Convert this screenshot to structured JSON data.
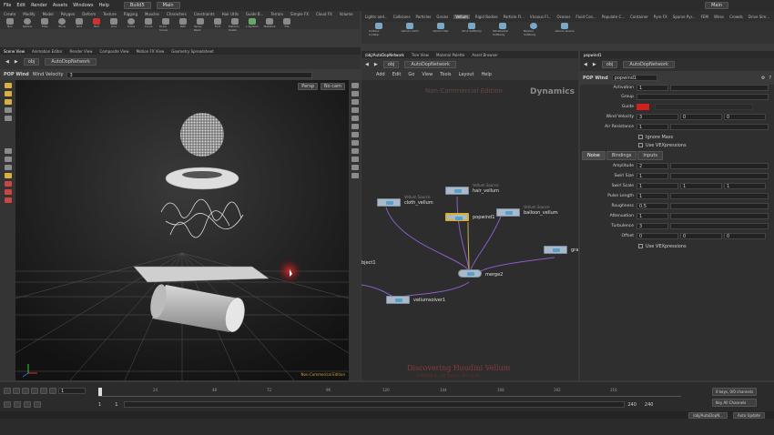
{
  "menu": [
    "File",
    "Edit",
    "Render",
    "Assets",
    "Windows",
    "Help"
  ],
  "desktop": {
    "name": "Build5",
    "context": "Main",
    "right_context": "Main"
  },
  "left_shelf_tabs": [
    "Create",
    "Modify",
    "Model",
    "Polygon",
    "Deform",
    "Texture",
    "Rigging",
    "Muscles",
    "Characters",
    "Constraints",
    "Hair Utils",
    "Guide B...",
    "Terrain",
    "Simple FX",
    "Cloud FX",
    "Volume"
  ],
  "left_tools": [
    "Box",
    "Sphere",
    "Tube",
    "Torus",
    "Grid",
    "Null",
    "Line",
    "Circle",
    "Curve",
    "Draw Curve",
    "Path",
    "Spray Paint",
    "Font",
    "Platonic Solids",
    "L-System",
    "Metaball",
    "File"
  ],
  "right_shelf_tabs": [
    "Lights and...",
    "Collisions",
    "Particles",
    "Grains",
    "Vellum",
    "Rigid Bodies",
    "Particle Fl...",
    "Viscous Fl...",
    "Oceans",
    "Fluid Con...",
    "Populate C...",
    "Container",
    "Pyro FX",
    "Sparse Pyr...",
    "FEM",
    "Wires",
    "Crowds",
    "Drive Sim..."
  ],
  "right_tools": [
    "Surface Collider",
    "Vellum Cloth",
    "Vellum Hair",
    "Strut Softbody",
    "Tetrahedral Softbody",
    "Balloon Softbody",
    "Vellum Grains"
  ],
  "left_pane_tabs": [
    "Scene View",
    "Animation Editor",
    "Render View",
    "Composite View",
    "Motion FX View",
    "Geometry Spreadsheet"
  ],
  "left_path": {
    "root": "obj",
    "network": "AutoDopNetwork"
  },
  "pop_wind_header": {
    "title": "POP Wind",
    "field": "Wind Velocity",
    "value": "3"
  },
  "viewport": {
    "persp": "Persp",
    "cam": "No cam",
    "watermark": "Non-Commercial Edition"
  },
  "network_tabs": [
    "/obj/AutoDopNetwork",
    "Tree View",
    "Material Palette",
    "Asset Browser"
  ],
  "network_path": {
    "root": "obj",
    "network": "AutoDopNetwork"
  },
  "network_menu": [
    "Add",
    "Edit",
    "Go",
    "View",
    "Tools",
    "Layout",
    "Help"
  ],
  "network_overlay": {
    "watermark": "Non-Commercial Edition",
    "context": "Dynamics",
    "title": "Discovering Houdini Vellum",
    "subtitle": "Volume 1, by Jason Morgan"
  },
  "nodes": [
    {
      "name": "cloth_vellum",
      "sub": "Vellum Source"
    },
    {
      "name": "hair_vellum",
      "sub": "Vellum Source"
    },
    {
      "name": "popwind1",
      "sub": ""
    },
    {
      "name": "balloon_vellum",
      "sub": "Vellum Source"
    },
    {
      "name": "merge2",
      "sub": ""
    },
    {
      "name": "vellumsolver1",
      "sub": ""
    },
    {
      "name": "bject1",
      "sub": ""
    },
    {
      "name": "gra",
      "sub": ""
    }
  ],
  "parm_tabs": [
    "popwind1"
  ],
  "parm_path": {
    "root": "obj",
    "network": "AutoDopNetwork"
  },
  "parm_header": {
    "type": "POP Wind",
    "name": "popwind1"
  },
  "parms": {
    "activation": {
      "label": "Activation",
      "value": "1"
    },
    "group": {
      "label": "Group"
    },
    "guide": {
      "label": "Guide",
      "color": "#d41f1f"
    },
    "wind_velocity": {
      "label": "Wind Velocity",
      "x": "3",
      "y": "0",
      "z": "0"
    },
    "air_resistance": {
      "label": "Air Resistance",
      "value": "1"
    },
    "ignore_mass": "Ignore Mass",
    "use_vex": "Use VEXpressions"
  },
  "subtabs": [
    "Noise",
    "Bindings",
    "Inputs"
  ],
  "noise": {
    "amplitude": {
      "label": "Amplitude",
      "value": "2"
    },
    "swirl_size": {
      "label": "Swirl Size",
      "value": "1"
    },
    "swirl_scale": {
      "label": "Swirl Scale",
      "x": "1",
      "y": "1",
      "z": "1"
    },
    "pulse_length": {
      "label": "Pulse Length",
      "value": "1"
    },
    "roughness": {
      "label": "Roughness",
      "value": "0.5"
    },
    "attenuation": {
      "label": "Attenuation",
      "value": "1"
    },
    "turbulence": {
      "label": "Turbulence",
      "value": "3"
    },
    "offset": {
      "label": "Offset",
      "x": "0",
      "y": "0",
      "z": "0"
    },
    "use_vex": "Use VEXpressions"
  },
  "timeline": {
    "frame": "1",
    "start": "1",
    "start2": "1",
    "end": "240",
    "end2": "240",
    "ticks": [
      "24",
      "48",
      "72",
      "96",
      "120",
      "144",
      "168",
      "192",
      "216"
    ],
    "keys": "0 keys, 0/0 channels",
    "key_all": "Key All Channels",
    "path": "/obj/AutoDopN...",
    "update": "Auto Update"
  }
}
